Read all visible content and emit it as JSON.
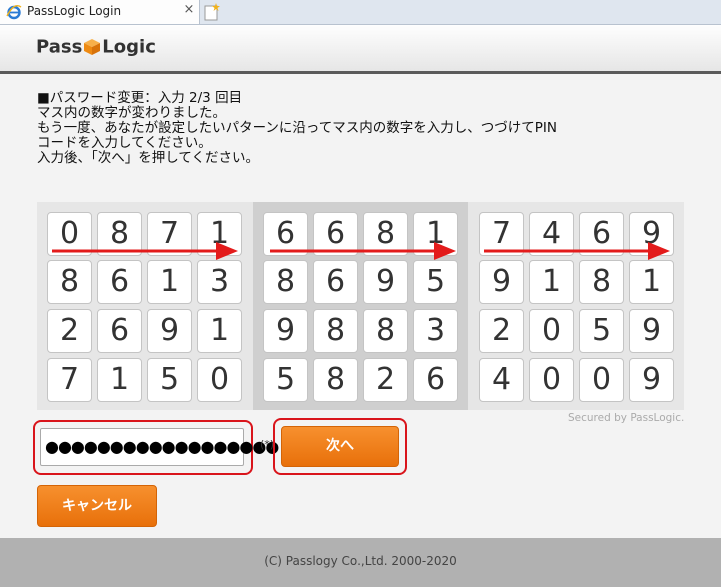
{
  "browser": {
    "tab_title": "PassLogic Login",
    "close_glyph": "×"
  },
  "header": {
    "logo_left": "Pass",
    "logo_right": "Logic",
    "logo_color": "#f39a1d"
  },
  "instructions": {
    "lines": [
      "■パスワード変更：入力 2/3 回目",
      "マス内の数字が変わりました。",
      "もう一度、あなたが設定したいパターンに沿ってマス内の数字を入力し、つづけてPIN",
      "コードを入力してください。",
      "入力後、「次へ」を押してください。"
    ]
  },
  "grid": {
    "blocks": [
      [
        [
          "0",
          "8",
          "7",
          "1"
        ],
        [
          "8",
          "6",
          "1",
          "3"
        ],
        [
          "2",
          "6",
          "9",
          "1"
        ],
        [
          "7",
          "1",
          "5",
          "0"
        ]
      ],
      [
        [
          "6",
          "6",
          "8",
          "1"
        ],
        [
          "8",
          "6",
          "9",
          "5"
        ],
        [
          "9",
          "8",
          "8",
          "3"
        ],
        [
          "5",
          "8",
          "2",
          "6"
        ]
      ],
      [
        [
          "7",
          "4",
          "6",
          "9"
        ],
        [
          "9",
          "1",
          "8",
          "1"
        ],
        [
          "2",
          "0",
          "5",
          "9"
        ],
        [
          "4",
          "0",
          "0",
          "9"
        ]
      ]
    ],
    "arrow_color": "#e31b1b"
  },
  "secured_label": "Secured by PassLogic.",
  "form": {
    "password_value": "●●●●●●●●●●●●●●●●●●",
    "required_mark": "(*)",
    "next_label": "次へ",
    "cancel_label": "キャンセル",
    "accent": "#f28322",
    "highlight_color": "#d9141b"
  },
  "footer": {
    "copyright": "(C) Passlogy Co.,Ltd. 2000-2020"
  }
}
